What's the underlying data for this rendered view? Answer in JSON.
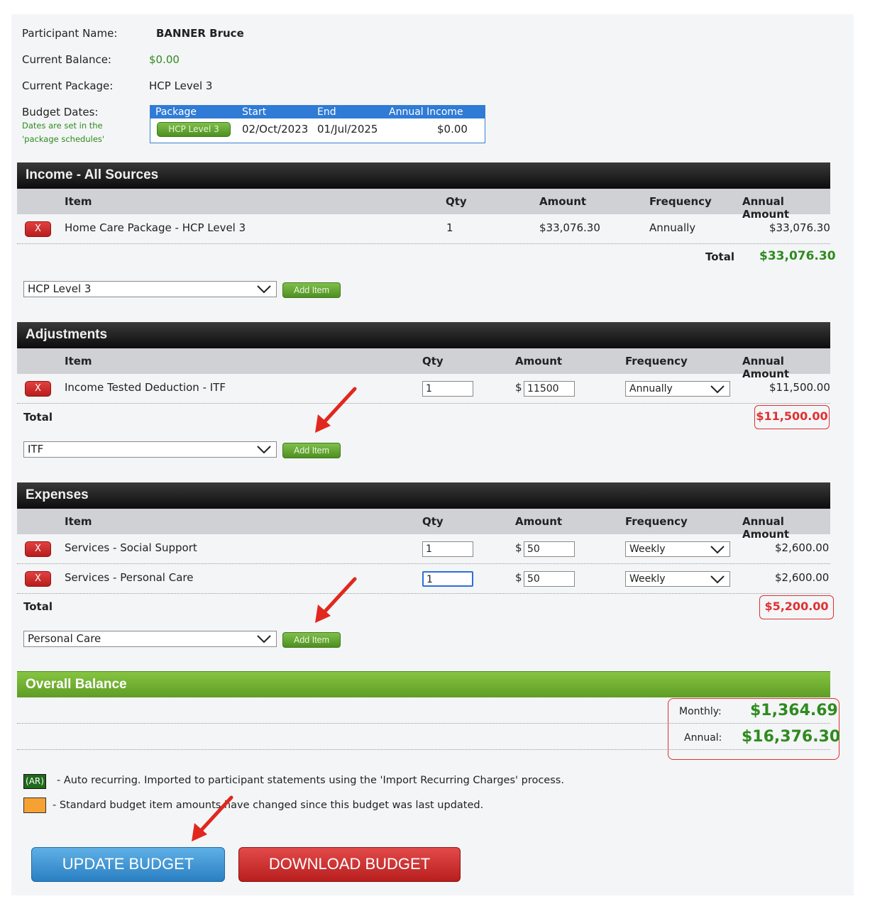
{
  "header": {
    "participant_label": "Participant Name:",
    "participant_value": "BANNER Bruce",
    "balance_label": "Current Balance:",
    "balance_value": "$0.00",
    "package_label": "Current Package:",
    "package_value": "HCP Level 3",
    "budget_dates_label": "Budget Dates:",
    "budget_dates_note": "Dates are set in the 'package schedules'"
  },
  "budget_dates_table": {
    "headers": [
      "Package",
      "Start",
      "End",
      "Annual Income"
    ],
    "row": {
      "package": "HCP Level 3",
      "start": "02/Oct/2023",
      "end": "01/Jul/2025",
      "annual_income": "$0.00"
    }
  },
  "income": {
    "title": "Income - All Sources",
    "columns": {
      "item": "Item",
      "qty": "Qty",
      "amount": "Amount",
      "frequency": "Frequency",
      "annual": "Annual Amount"
    },
    "rows": [
      {
        "remove": "X",
        "item": "Home Care Package - HCP Level 3",
        "qty": "1",
        "amount": "$33,076.30",
        "frequency": "Annually",
        "annual": "$33,076.30"
      }
    ],
    "total_label": "Total",
    "total_value": "$33,076.30",
    "select_value": "HCP Level 3",
    "add_label": "Add Item"
  },
  "adjustments": {
    "title": "Adjustments",
    "columns": {
      "item": "Item",
      "qty": "Qty",
      "amount": "Amount",
      "frequency": "Frequency",
      "annual": "Annual Amount"
    },
    "rows": [
      {
        "remove": "X",
        "item": "Income Tested Deduction - ITF",
        "qty": "1",
        "currency": "$",
        "amount": "11500",
        "frequency": "Annually",
        "annual": "$11,500.00"
      }
    ],
    "total_label": "Total",
    "total_value": "$11,500.00",
    "select_value": "ITF",
    "add_label": "Add Item"
  },
  "expenses": {
    "title": "Expenses",
    "columns": {
      "item": "Item",
      "qty": "Qty",
      "amount": "Amount",
      "frequency": "Frequency",
      "annual": "Annual Amount"
    },
    "rows": [
      {
        "remove": "X",
        "item": "Services - Social Support",
        "qty": "1",
        "currency": "$",
        "amount": "50",
        "frequency": "Weekly",
        "annual": "$2,600.00"
      },
      {
        "remove": "X",
        "item": "Services - Personal Care",
        "qty": "1",
        "currency": "$",
        "amount": "50",
        "frequency": "Weekly",
        "annual": "$2,600.00"
      }
    ],
    "total_label": "Total",
    "total_value": "$5,200.00",
    "select_value": "Personal Care",
    "add_label": "Add Item"
  },
  "overall": {
    "title": "Overall Balance",
    "monthly_label": "Monthly:",
    "monthly_value": "$1,364.69",
    "annual_label": "Annual:",
    "annual_value": "$16,376.30"
  },
  "legend": {
    "ar_badge": "(AR)",
    "ar_text": "- Auto recurring. Imported to participant statements using the 'Import Recurring Charges' process.",
    "orange_text": "- Standard budget item amounts have changed since this budget was last updated."
  },
  "actions": {
    "update_label": "UPDATE BUDGET",
    "download_label": "DOWNLOAD BUDGET"
  },
  "colors": {
    "accent_green": "#2e8b1e",
    "alert_red": "#e03030",
    "header_blue": "#2f7bd6",
    "update_blue": "#3a8fd0",
    "download_red": "#cc2a2a"
  },
  "icons": [
    "chevron-down-icon",
    "remove-x-icon",
    "arrow-annotation-icon"
  ]
}
